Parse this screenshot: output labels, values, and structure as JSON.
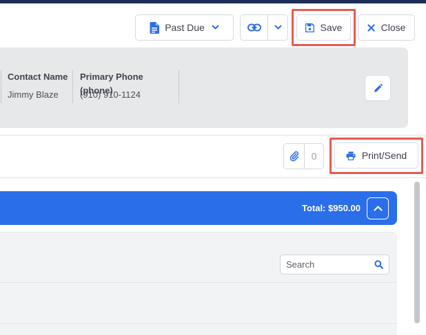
{
  "toolbar": {
    "status_label": "Past Due",
    "save_label": "Save",
    "close_label": "Close"
  },
  "contact": {
    "fields": [
      {
        "header": "Contact Name",
        "value": "Jimmy Blaze"
      },
      {
        "header": "Primary Phone (phone)",
        "value": "(910) 910-1124"
      }
    ]
  },
  "actions": {
    "attachment_count": "0",
    "print_label": "Print/Send"
  },
  "totals": {
    "total_label": "Total: $950.00"
  },
  "search": {
    "placeholder": "Search"
  },
  "colors": {
    "accent": "#2a6ee9",
    "highlight": "#e85a4f",
    "header": "#1c2d56"
  },
  "icons": [
    "file-icon",
    "chevron-down-icon",
    "link-icon",
    "save-icon",
    "close-icon",
    "pencil-icon",
    "paperclip-icon",
    "printer-icon",
    "chevron-up-icon",
    "search-icon"
  ]
}
